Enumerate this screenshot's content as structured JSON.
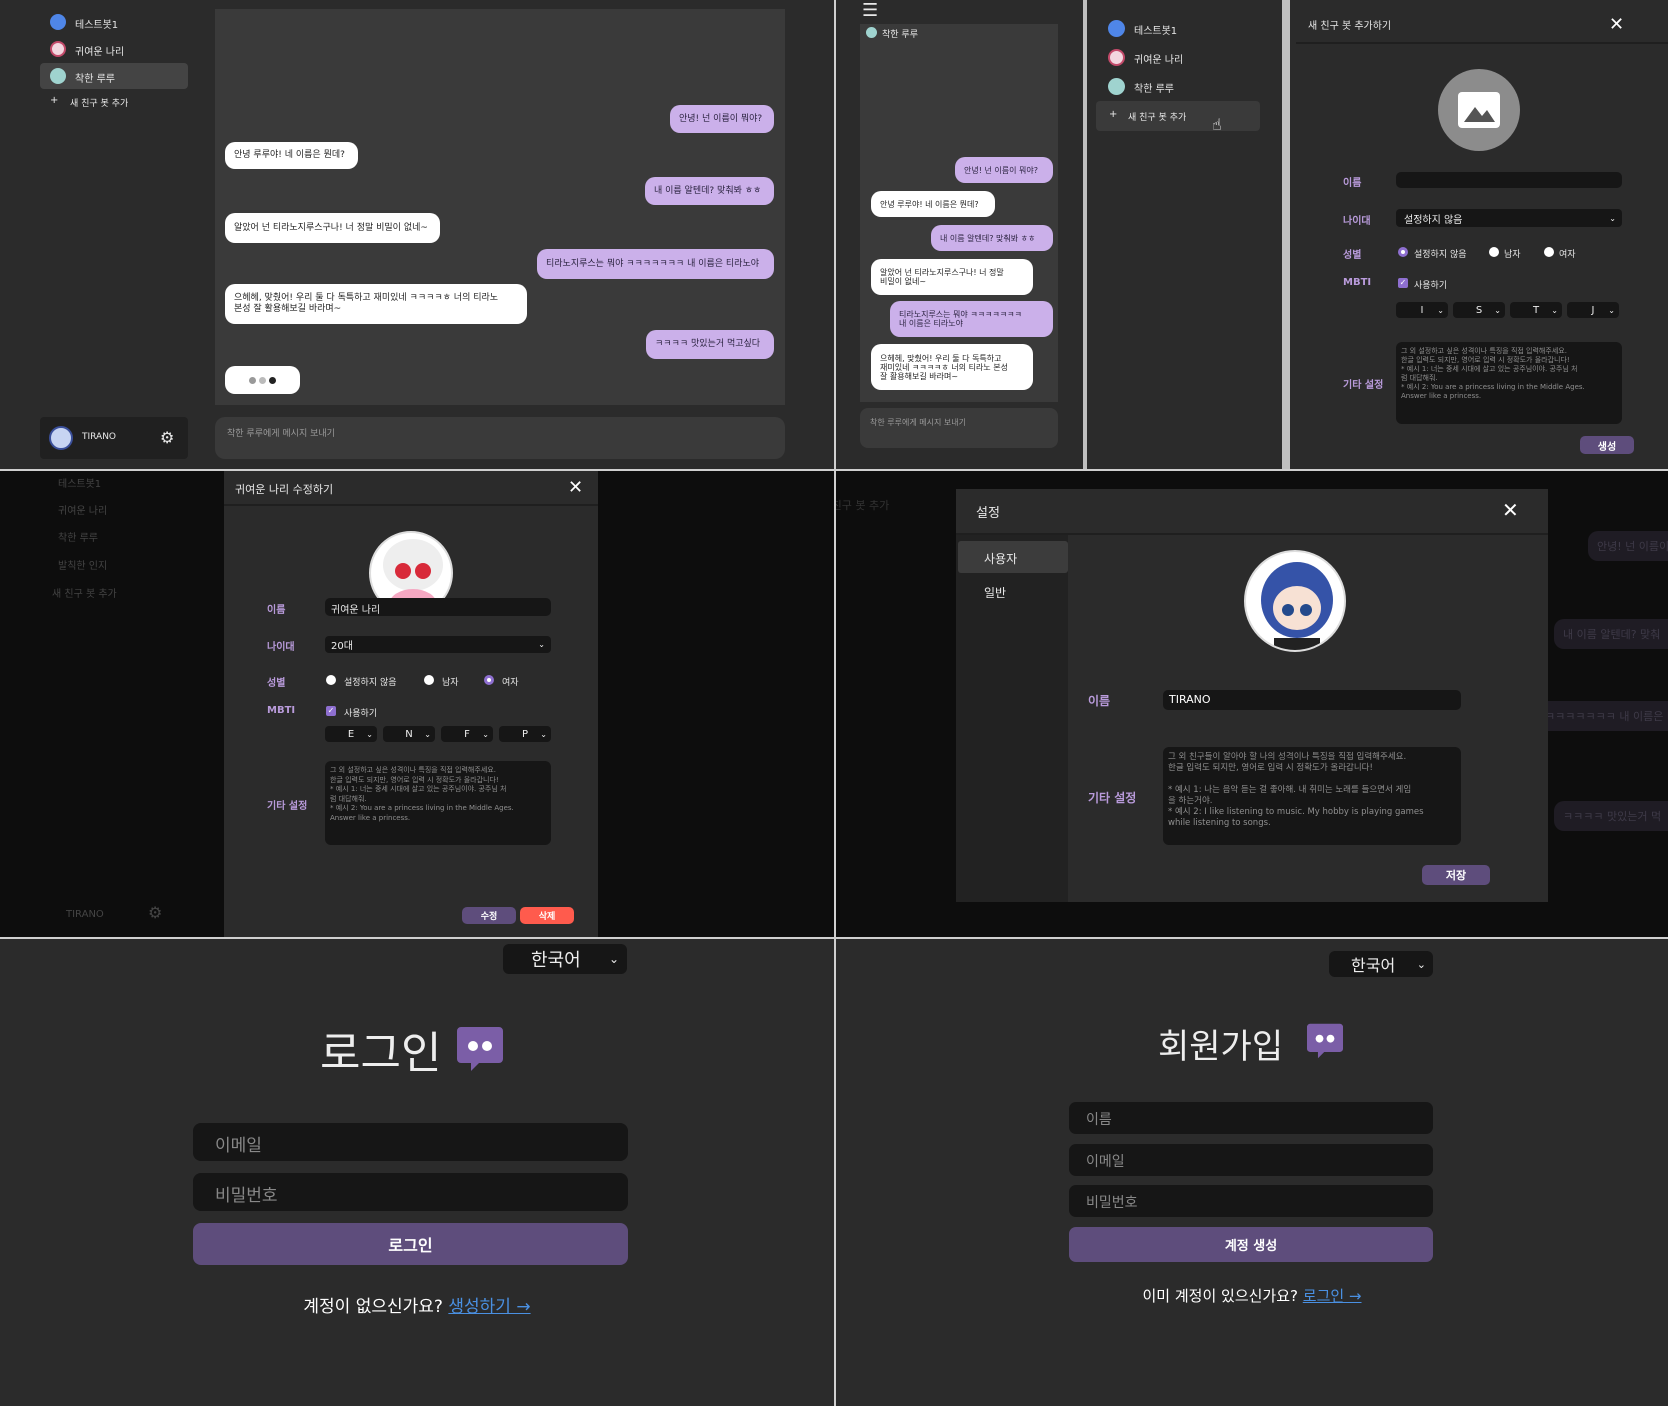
{
  "bots": [
    "테스트봇1",
    "귀여운 나리",
    "착한 루루",
    "발칙한 인지"
  ],
  "add_bot": "새 친구 봇 추가",
  "username": "TIRANO",
  "chat": {
    "messages": [
      {
        "from": "user",
        "text": "안녕! 넌 이름이 뭐야?"
      },
      {
        "from": "bot",
        "text": "안녕 루루야! 네 이름은 뭔데?"
      },
      {
        "from": "user",
        "text": "내 이름 알텐데? 맞춰봐 ㅎㅎ"
      },
      {
        "from": "bot",
        "text": "알았어 넌 티라노지루스구나! 너 정말 비밀이 없네~"
      },
      {
        "from": "user",
        "text": "티라노지루스는 뭐야 ㅋㅋㅋㅋㅋㅋㅋ 내 이름은 티라노야"
      },
      {
        "from": "bot",
        "text": "으헤헤, 맞췄어! 우리 둘 다 독특하고 재미있네 ㅋㅋㅋㅋㅎ 너의 티라노\n본성 잘 활용해보길 바라며~"
      },
      {
        "from": "user",
        "text": "ㅋㅋㅋㅋ 맛있는거 먹고싶다"
      }
    ],
    "input_placeholder": "착한 루루에게 메시지 보내기",
    "active_bot": "착한 루루"
  },
  "mobile": {
    "messages": [
      {
        "from": "user",
        "text": "안녕! 넌 이름이 뭐야?"
      },
      {
        "from": "bot",
        "text": "안녕 루루야! 네 이름은 뭔데?"
      },
      {
        "from": "user",
        "text": "내 이름 알텐데? 맞춰봐 ㅎㅎ"
      },
      {
        "from": "bot",
        "text": "알았어 넌 티라노지루스구나! 너 정말\n비밀이 없네~"
      },
      {
        "from": "user",
        "text": "티라노지루스는 뭐야 ㅋㅋㅋㅋㅋㅋㅋ\n내 이름은 티라노야"
      },
      {
        "from": "bot",
        "text": "으헤헤, 맞췄어! 우리 둘 다 독특하고\n재미있네 ㅋㅋㅋㅋㅎ 너의 티라노 본성\n잘 활용해보길 바라며~"
      }
    ]
  },
  "add_modal": {
    "title": "새 친구 봇 추가하기",
    "labels": {
      "name": "이름",
      "age": "나이대",
      "gender": "성별",
      "mbti": "MBTI",
      "other": "기타 설정"
    },
    "age_value": "설정하지 않음",
    "gender_options": [
      "설정하지 않음",
      "남자",
      "여자"
    ],
    "mbti_use": "사용하기",
    "mbti": [
      "I",
      "S",
      "T",
      "J"
    ],
    "other_placeholder": "그 외 설정하고 싶은 성격이나 특징을 직접 입력해주세요.\n한글 입력도 되지만, 영어로 입력 시 정확도가 올라갑니다!\n* 예시 1: 너는 중세 시대에 살고 있는 공주님이야. 공주님 처\n럼 대답해줘.\n* 예시 2: You are a princess living in the Middle Ages.\nAnswer like a princess.",
    "create": "생성"
  },
  "edit_modal": {
    "title": "귀여운 나리 수정하기",
    "name_value": "귀여운 나리",
    "age_value": "20대",
    "mbti": [
      "E",
      "N",
      "F",
      "P"
    ],
    "edit": "수정",
    "delete": "삭제"
  },
  "settings": {
    "title": "설정",
    "tabs": [
      "사용자",
      "일반"
    ],
    "name_label": "이름",
    "name_value": "TIRANO",
    "other_label": "기타 설정",
    "other_placeholder": "그 외 친구들이 알아야 할 나의 성격이나 특징을 직접 입력해주세요.\n한글 입력도 되지만, 영어로 입력 시 정확도가 올라갑니다!\n\n* 예시 1: 나는 음악 듣는 걸 좋아해. 내 취미는 노래를 들으면서 게임\n을 하는거야.\n* 예시 2: I like listening to music. My hobby is playing games\nwhile listening to songs.",
    "save": "저장",
    "bg_bubbles": [
      "안녕! 넌 이름이",
      "내 이름 알텐데? 맞춰",
      "ㅋㅋㅋㅋㅋㅋㅋ 내 이름은 티",
      "ㅋㅋㅋㅋ 맛있는거 먹"
    ]
  },
  "login": {
    "language": "한국어",
    "title": "로그인",
    "email_placeholder": "이메일",
    "password_placeholder": "비밀번호",
    "submit": "로그인",
    "prompt": "계정이 없으신가요?",
    "link": "생성하기 →"
  },
  "signup": {
    "language": "한국어",
    "title": "회원가입",
    "name_placeholder": "이름",
    "email_placeholder": "이메일",
    "password_placeholder": "비밀번호",
    "submit": "계정 생성",
    "prompt": "이미 계정이 있으신가요?",
    "link": "로그인 →"
  },
  "colors": {
    "accent": "#5e4d7c",
    "bubble_user": "#cbb0ea",
    "bg": "#2b2b2b",
    "link": "#4a90e2"
  }
}
